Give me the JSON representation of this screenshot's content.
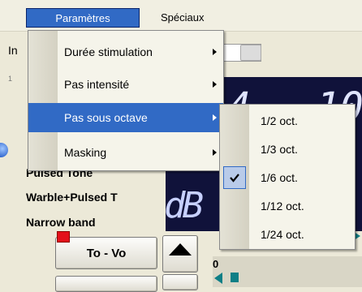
{
  "menubar": {
    "items": [
      {
        "label": "Paramètres",
        "active": true
      },
      {
        "label": "Spéciaux",
        "active": false
      }
    ]
  },
  "background": {
    "in_label": "In",
    "small_number": "1",
    "labels": [
      "Pulsed Tone",
      "Warble+Pulsed T",
      "Narrow band"
    ],
    "display": {
      "digits_a": "4",
      "digits_b": "10",
      "db": "dB"
    },
    "buttons": {
      "tovo_label": "To - Vo"
    },
    "zero": "0"
  },
  "main_menu": {
    "items": [
      {
        "label": "Durée stimulation",
        "has_submenu": true,
        "highlighted": false
      },
      {
        "label": "Pas intensité",
        "has_submenu": true,
        "highlighted": false
      },
      {
        "label": "Pas sous octave",
        "has_submenu": true,
        "highlighted": true
      },
      {
        "label": "Masking",
        "has_submenu": true,
        "highlighted": false
      }
    ]
  },
  "sub_menu": {
    "items": [
      {
        "label": "1/2 oct.",
        "checked": false
      },
      {
        "label": "1/3 oct.",
        "checked": false
      },
      {
        "label": "1/6  oct.",
        "checked": true
      },
      {
        "label": "1/12 oct.",
        "checked": false
      },
      {
        "label": "1/24 oct.",
        "checked": false
      }
    ]
  },
  "colors": {
    "highlight": "#316ac5",
    "display_bg": "#10123a",
    "window_bg": "#ece9d8",
    "accent_teal": "#0e7f86",
    "flag_red": "#e3101a"
  },
  "icons": [
    "chevron-right-icon",
    "checkmark-icon",
    "arrow-up-icon",
    "play-right-icon",
    "play-left-icon",
    "stop-icon",
    "red-flag-icon"
  ]
}
